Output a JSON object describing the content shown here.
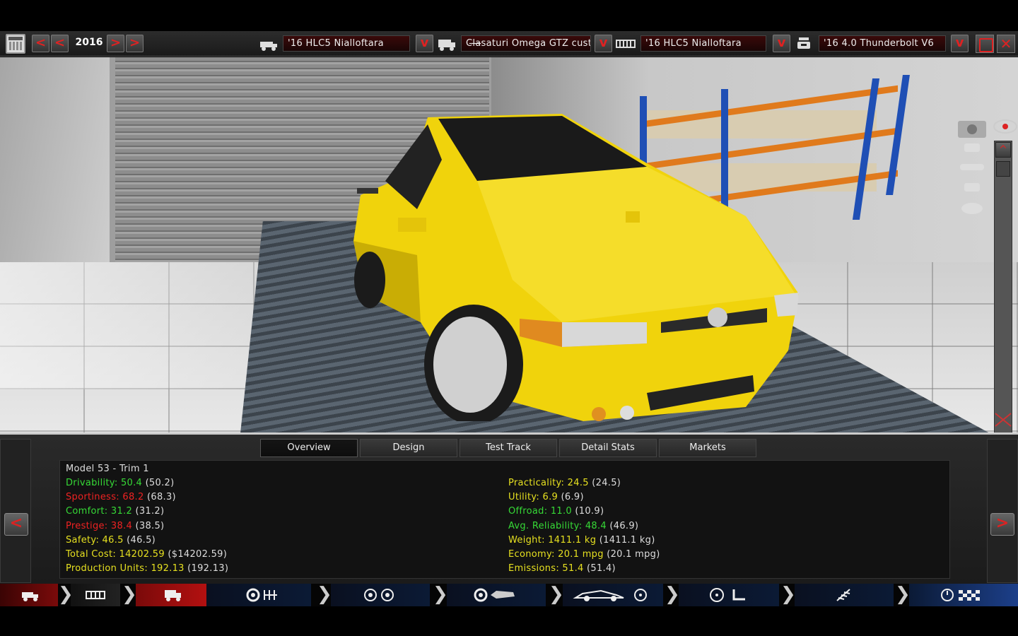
{
  "topbar": {
    "year": "2016",
    "nav_prev_fast": "<",
    "nav_prev": "<",
    "nav_next": ">",
    "nav_next_fast": ">",
    "model_platform": "'16   HLC5 Nialloftara",
    "model_current": "Cl̶a̶saturi Omega GTZ custom",
    "chassis": "'16   HLC5 Nialloftara",
    "engine": "'16 4.0 Thunderbolt V6",
    "dropdown_glyph": "v",
    "close_glyph": "✕"
  },
  "viewport": {
    "scroll_up": "^",
    "scroll_down": "v"
  },
  "tabs": [
    {
      "label": "Overview",
      "active": true
    },
    {
      "label": "Design",
      "active": false
    },
    {
      "label": "Test Track",
      "active": false
    },
    {
      "label": "Detail Stats",
      "active": false
    },
    {
      "label": "Markets",
      "active": false
    }
  ],
  "overview": {
    "title": "Model 53 - Trim 1",
    "left": [
      {
        "label": "Drivability: 50.4",
        "paren": "(50.2)",
        "color": "g"
      },
      {
        "label": "Sportiness: 68.2",
        "paren": "(68.3)",
        "color": "r"
      },
      {
        "label": "Comfort: 31.2",
        "paren": "(31.2)",
        "color": "g"
      },
      {
        "label": "Prestige: 38.4",
        "paren": "(38.5)",
        "color": "r"
      },
      {
        "label": "Safety: 46.5",
        "paren": "(46.5)",
        "color": "y"
      },
      {
        "label": "Total Cost: 14202.59",
        "paren": "($14202.59)",
        "color": "y"
      },
      {
        "label": "Production Units: 192.13",
        "paren": "(192.13)",
        "color": "y"
      }
    ],
    "right": [
      {
        "label": "Practicality: 24.5",
        "paren": "(24.5)",
        "color": "y"
      },
      {
        "label": "Utility: 6.9",
        "paren": "(6.9)",
        "color": "y"
      },
      {
        "label": "Offroad: 11.0",
        "paren": "(10.9)",
        "color": "g"
      },
      {
        "label": "Avg. Reliability: 48.4",
        "paren": "(46.9)",
        "color": "g"
      },
      {
        "label": "Weight: 1411.1 kg",
        "paren": "(1411.1 kg)",
        "color": "y"
      },
      {
        "label": "Economy: 20.1 mpg",
        "paren": "(20.1 mpg)",
        "color": "y"
      },
      {
        "label": "Emissions: 51.4",
        "paren": "(51.4)",
        "color": "y"
      }
    ]
  },
  "panel_nav": {
    "prev": "<",
    "next": ">"
  },
  "colors": {
    "accent_red": "#dd2222",
    "stat_good": "#36d936",
    "stat_bad": "#ee2222",
    "stat_neutral": "#e6e020",
    "car_yellow": "#f2d90a"
  }
}
